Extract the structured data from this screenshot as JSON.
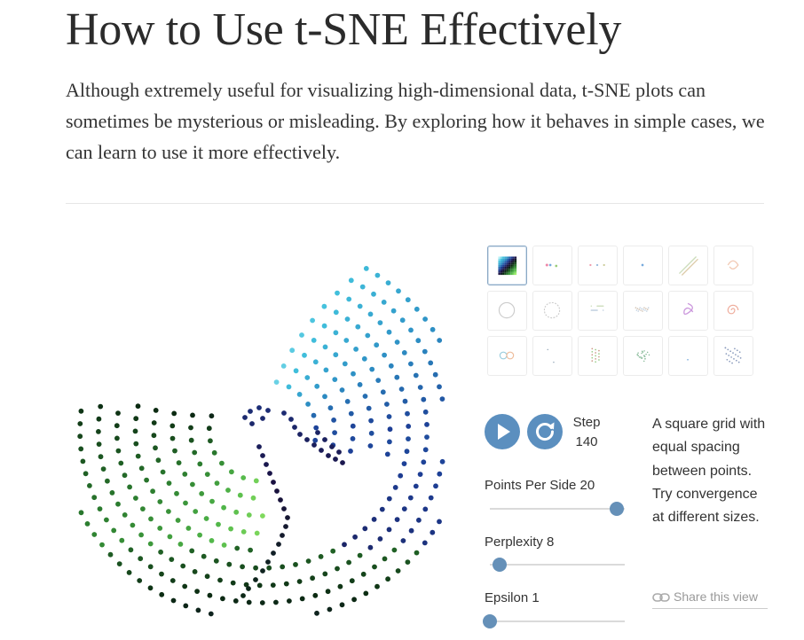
{
  "page": {
    "title": "How to Use t-SNE Effectively",
    "lede": "Although extremely useful for visualizing high-dimensional data, t-SNE plots can sometimes be mysterious or misleading. By exploring how it behaves in simple cases, we can learn to use it more effectively."
  },
  "dataset_gallery": {
    "selected_index": 0,
    "thumbnails": [
      {
        "icon": "square-grid-icon"
      },
      {
        "icon": "two-clusters-icon"
      },
      {
        "icon": "three-clusters-icon"
      },
      {
        "icon": "single-point-icon"
      },
      {
        "icon": "parallel-lines-icon"
      },
      {
        "icon": "swirl-icon"
      },
      {
        "icon": "circle-icon"
      },
      {
        "icon": "dashed-circle-icon"
      },
      {
        "icon": "scattered-blob-icon"
      },
      {
        "icon": "elongated-blob-icon"
      },
      {
        "icon": "trefoil-icon"
      },
      {
        "icon": "spiral-icon"
      },
      {
        "icon": "linked-rings-icon"
      },
      {
        "icon": "sparse-dots-icon"
      },
      {
        "icon": "random-walk-icon"
      },
      {
        "icon": "gaussian-cloud-icon"
      },
      {
        "icon": "small-dot-icon"
      },
      {
        "icon": "uniform-scatter-icon"
      }
    ]
  },
  "controls": {
    "step_label": "Step",
    "step_value": "140",
    "params": [
      {
        "label": "Points Per Side 20",
        "value": 0.94
      },
      {
        "label": "Perplexity 8",
        "value": 0.07
      },
      {
        "label": "Epsilon 1",
        "value": 0.0
      }
    ]
  },
  "description": "A square grid with equal spacing between points. Try convergence at different sizes.",
  "share_label": "Share this view",
  "colors": {
    "accent": "#5b8fbf",
    "knob": "#6590b8",
    "gradient": [
      "#b3f0f5",
      "#41c0dc",
      "#2d8fc4",
      "#1d3f96",
      "#1a1040",
      "#0b2a12",
      "#2a7a2e",
      "#52b84a",
      "#9ef06a"
    ]
  }
}
